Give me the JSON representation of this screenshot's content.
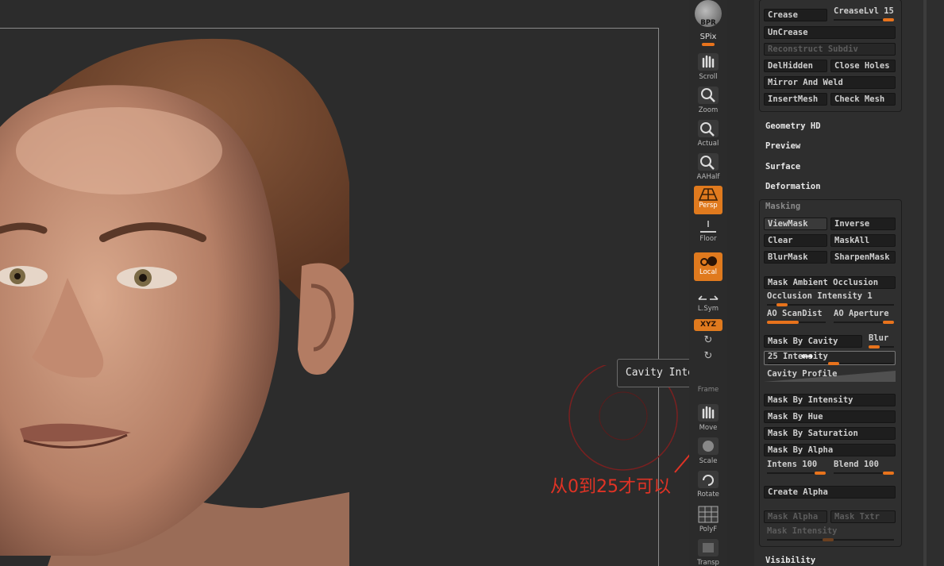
{
  "viewport": {
    "tooltip": "Cavity Intensity",
    "annotation": "从0到25才可以"
  },
  "shelf": {
    "bpr": "BPR",
    "spix": "SPix",
    "scroll": "Scroll",
    "zoom": "Zoom",
    "actual": "Actual",
    "aahalf": "AAHalf",
    "persp": "Persp",
    "floor": "Floor",
    "local": "Local",
    "lsym": "L.Sym",
    "xyz": "XYZ",
    "frame": "Frame",
    "move": "Move",
    "scale": "Scale",
    "rotate": "Rotate",
    "polyf": "PolyF",
    "transp": "Transp"
  },
  "geometry": {
    "crease": "Crease",
    "creaselvl": "CreaseLvl",
    "creaselvl_value": "15",
    "uncrease": "UnCrease",
    "reconstruct": "Reconstruct Subdiv",
    "delhidden": "DelHidden",
    "close_holes": "Close Holes",
    "mirror_weld": "Mirror And Weld",
    "insertmesh": "InsertMesh",
    "check_mesh": "Check Mesh"
  },
  "sections": {
    "geometry_hd": "Geometry HD",
    "preview": "Preview",
    "surface": "Surface",
    "deformation": "Deformation",
    "visibility": "Visibility"
  },
  "masking": {
    "title": "Masking",
    "viewmask": "ViewMask",
    "inverse": "Inverse",
    "clear": "Clear",
    "maskall": "MaskAll",
    "blurmask": "BlurMask",
    "sharpenmask": "SharpenMask",
    "mask_ao": "Mask Ambient Occlusion",
    "occlusion_intensity": "Occlusion Intensity 1",
    "ao_scandist": "AO ScanDist",
    "ao_aperture": "AO Aperture",
    "mask_by_cavity": "Mask By Cavity",
    "blur": "Blur",
    "intensity_value": "25",
    "intensity_label": "Intensity",
    "cavity_profile": "Cavity Profile",
    "mask_by_intensity": "Mask By Intensity",
    "mask_by_hue": "Mask By Hue",
    "mask_by_saturation": "Mask By Saturation",
    "mask_by_alpha": "Mask By Alpha",
    "intens": "Intens",
    "intens_value": "100",
    "blend": "Blend",
    "blend_value": "100",
    "create_alpha": "Create Alpha",
    "mask_alpha": "Mask Alpha",
    "mask_txtr": "Mask Txtr",
    "mask_intensity": "Mask Intensity"
  },
  "colors": {
    "accent": "#e8731c",
    "annotation": "#e03325"
  }
}
